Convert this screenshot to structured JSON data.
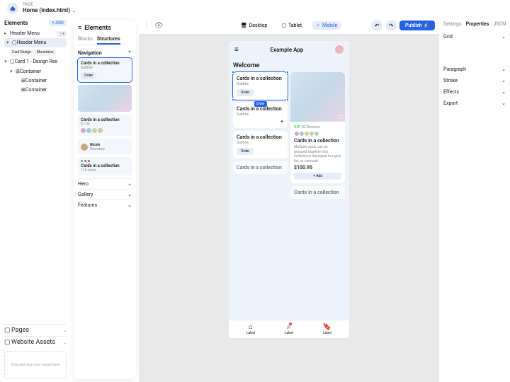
{
  "header": {
    "page_label": "PAGE",
    "page_name": "Home (index.html)"
  },
  "left": {
    "elements_title": "Elements",
    "add_label": "+ ADD",
    "tree": {
      "item0": "Header Menu",
      "badge0": "⋮≡",
      "item1": "Header Menu",
      "tags": [
        "Card Design",
        "Mountains"
      ],
      "item2": "Card 1 - Design Res",
      "item3": "Container",
      "item4": "Container",
      "item5": "Container"
    },
    "pages_title": "Pages",
    "assets_title": "Website Assets",
    "drop_text": "Drag and drop your assets here"
  },
  "elements_panel": {
    "title": "Elements",
    "tabs": {
      "blocks": "Blocks",
      "structures": "Structures"
    },
    "nav_section": "Navigation",
    "card1": {
      "title": "Cards in a collection",
      "sub": "Subtitle",
      "btn": "Order"
    },
    "card2": {
      "title": "Cards in a collection",
      "sub": "$1.99"
    },
    "card3": {
      "user": "Nicole",
      "role": "Secretary"
    },
    "card4": {
      "title": "Cards in a collection",
      "sub": "124 cards"
    },
    "sections": {
      "hero": "Hero",
      "gallery": "Gallery",
      "features": "Features"
    }
  },
  "toolbar": {
    "desktop": "Desktop",
    "tablet": "Tablet",
    "mobile": "Mobile",
    "publish": "Publish"
  },
  "phone": {
    "app_title": "Example App",
    "welcome": "Welcome",
    "card_a": {
      "title": "Cards in a collection",
      "sub": "Subtitle",
      "btn": "Order"
    },
    "card_b": {
      "title": "Cards in a collection",
      "sub": "Subtitle"
    },
    "card_c": {
      "title": "Cards in a collection",
      "sub": "Subtitle",
      "btn": "Order"
    },
    "card_d": {
      "rating": "4.91",
      "reviews": "52 Reviews",
      "title": "Cards in a collection",
      "desc": "Multiple cards can be grouped together into collections displayed in a grid, list, or carousel.",
      "price": "$100.95",
      "add": "+  Add"
    },
    "card_e": {
      "title": "Cards in a collection"
    },
    "card_f": {
      "title": "Cards in a collection"
    },
    "sel_label": "Order",
    "nav": {
      "label": "Label"
    }
  },
  "right": {
    "tabs": {
      "settings": "Settings",
      "properties": "Properties",
      "json": "JSON"
    },
    "rows": {
      "grid": "Grid",
      "paragraph": "Paragraph",
      "stroke": "Stroke",
      "effects": "Effects",
      "export": "Export"
    }
  }
}
